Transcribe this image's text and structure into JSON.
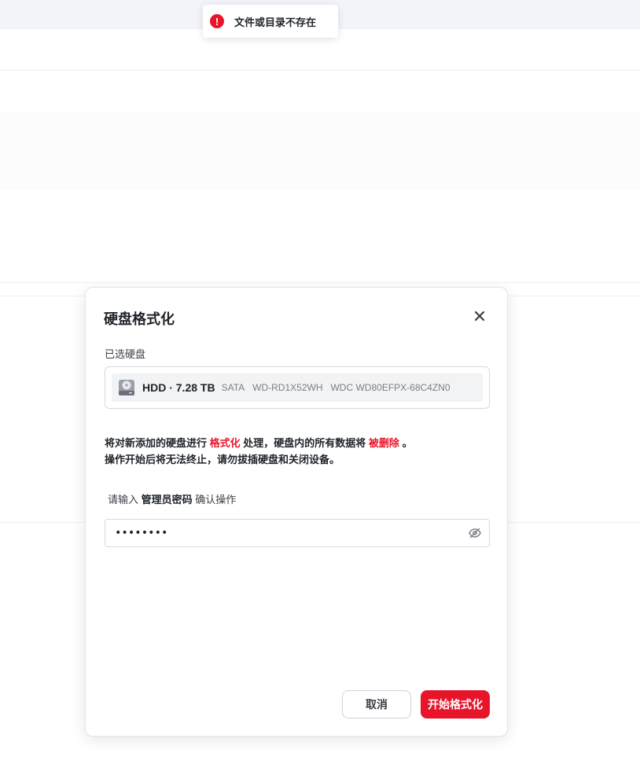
{
  "toast": {
    "icon": "error-icon",
    "message": "文件或目录不存在",
    "color": "#e8152a"
  },
  "dialog": {
    "title": "硬盘格式化",
    "close_icon": "close-icon",
    "selected_label": "已选硬盘",
    "disk": {
      "icon": "hard-drive-icon",
      "type_size": "HDD · 7.28 TB",
      "interface": "SATA",
      "serial": "WD-RD1X52WH",
      "model": "WDC WD80EFPX-68C4ZN0"
    },
    "warning": {
      "line1_a": "将对新添加的硬盘进行",
      "line1_em1": "格式化",
      "line1_b": "处理，硬盘内的所有数据将",
      "line1_em2": "被删除",
      "line1_c": "。",
      "line2": "操作开始后将无法终止，请勿拔插硬盘和关闭设备。"
    },
    "password_prompt": {
      "a": "请输入",
      "b": "管理员密码",
      "c": "确认操作"
    },
    "password_value": "••••••••",
    "eye_icon": "eye-off-icon",
    "cancel_label": "取消",
    "confirm_label": "开始格式化",
    "accent_color": "#e8152a"
  }
}
